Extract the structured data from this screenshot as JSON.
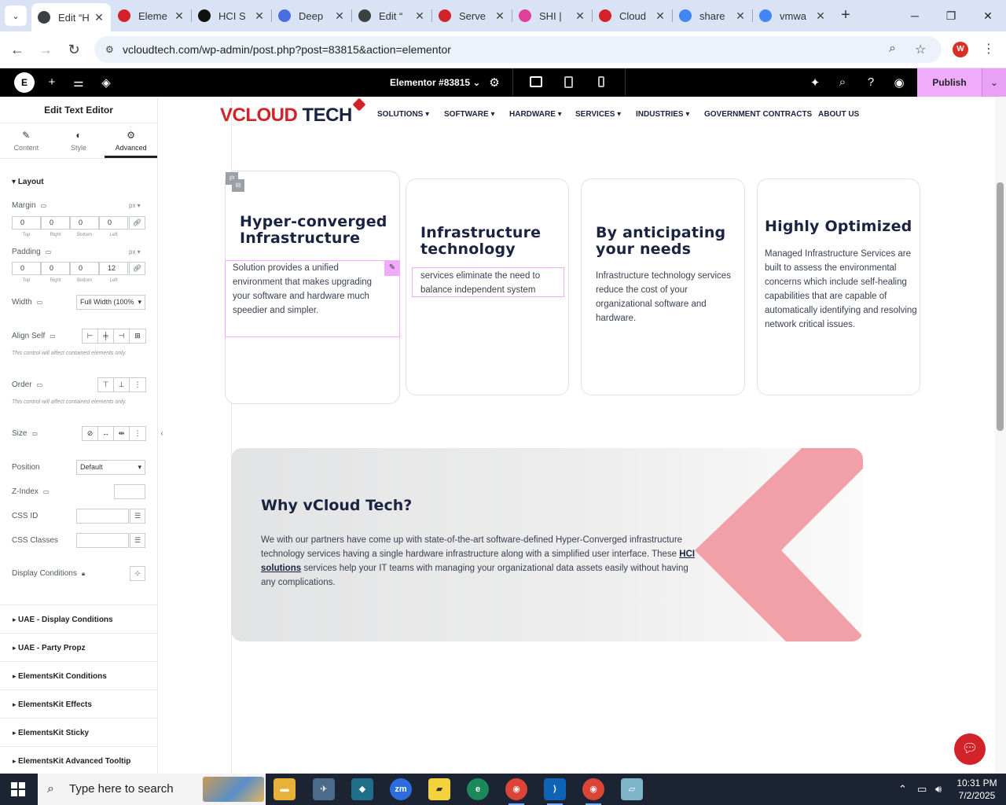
{
  "browser": {
    "tabs": [
      {
        "label": "Edit “H",
        "icon": "wordpress-icon",
        "color": "#3c4043",
        "active": true
      },
      {
        "label": "Eleme",
        "icon": "elementor-diamond-icon",
        "color": "#d2232a"
      },
      {
        "label": "HCI S",
        "icon": "openai-icon",
        "color": "#111111"
      },
      {
        "label": "Deep",
        "icon": "deepl-icon",
        "color": "#4a6ee0"
      },
      {
        "label": "Edit “",
        "icon": "wordpress-icon",
        "color": "#3c4043"
      },
      {
        "label": "Serve",
        "icon": "elementor-diamond-icon",
        "color": "#d2232a"
      },
      {
        "label": "SHI | ",
        "icon": "shi-ring-icon",
        "color": "#e0419a"
      },
      {
        "label": "Cloud",
        "icon": "cloud-logo-icon",
        "color": "#d2232a"
      },
      {
        "label": "share",
        "icon": "google-icon",
        "color": "#4285f4"
      },
      {
        "label": "vmwa",
        "icon": "google-icon",
        "color": "#4285f4"
      }
    ],
    "url": "vcloudtech.com/wp-admin/post.php?post=83815&action=elementor"
  },
  "editor": {
    "document_label": "Elementor #83815",
    "publish_label": "Publish"
  },
  "panel": {
    "title": "Edit Text Editor",
    "tabs": [
      {
        "label": "Content",
        "icon": "pencil-icon"
      },
      {
        "label": "Style",
        "icon": "half-circle-icon"
      },
      {
        "label": "Advanced",
        "icon": "gear-icon",
        "active": true
      }
    ],
    "section_layout": "Layout",
    "margin": {
      "label": "Margin",
      "unit": "px",
      "top": "0",
      "right": "0",
      "bottom": "0",
      "left": "0"
    },
    "padding": {
      "label": "Padding",
      "unit": "px",
      "top": "0",
      "right": "0",
      "bottom": "0",
      "left": "12"
    },
    "dim_captions": {
      "top": "Top",
      "right": "Right",
      "bottom": "Bottom",
      "left": "Left"
    },
    "width": {
      "label": "Width",
      "value": "Full Width (100%"
    },
    "align_self": {
      "label": "Align Self",
      "hint": "This control will affect contained elements only."
    },
    "order": {
      "label": "Order",
      "hint": "This control will affect contained elements only."
    },
    "size": {
      "label": "Size"
    },
    "position": {
      "label": "Position",
      "value": "Default"
    },
    "zindex": {
      "label": "Z-Index"
    },
    "css_id": {
      "label": "CSS ID"
    },
    "css_classes": {
      "label": "CSS Classes"
    },
    "display_conditions": {
      "label": "Display Conditions"
    },
    "accordions": [
      "UAE - Display Conditions",
      "UAE - Party Propz",
      "ElementsKit Conditions",
      "ElementsKit Effects",
      "ElementsKit Sticky",
      "ElementsKit Advanced Tooltip"
    ]
  },
  "site": {
    "logo_v": "V",
    "logo_cloud": "CLOUD",
    "logo_tech": "TECH",
    "menu": [
      "SOLUTIONS",
      "SOFTWARE",
      "HARDWARE",
      "SERVICES",
      "INDUSTRIES",
      "GOVERNMENT CONTRACTS",
      "ABOUT US"
    ],
    "cards": [
      {
        "title": "Hyper-converged Infrastructure",
        "text": "Solution provides a unified environment that makes upgrading your software and hardware much speedier and simpler."
      },
      {
        "title": "Infrastructure technology",
        "text": "services eliminate the need to balance independent system"
      },
      {
        "title": "By anticipating your needs",
        "text": "Infrastructure technology services reduce the cost of your organizational software and hardware."
      },
      {
        "title": "Highly Optimized",
        "text": "Managed Infrastructure Services are built to assess the environmental concerns which include self-healing capabilities that are capable of automatically identifying and resolving network critical issues."
      }
    ],
    "why": {
      "title": "Why vCloud Tech?",
      "text_before": "We with our partners have come up with state-of-the-art software-defined Hyper-Converged infrastructure technology services having a single hardware infrastructure along with a simplified user interface. These ",
      "link": "HCI solutions",
      "text_after": " services help your IT teams with managing your organizational data assets easily without having any complications."
    }
  },
  "taskbar": {
    "search_placeholder": "Type here to search",
    "time": "10:31 PM",
    "date": "7/2/2025"
  },
  "colors": {
    "accent_pink": "#f0abfc",
    "brand_red": "#d2232a",
    "navy": "#1a2440",
    "chevron_pink": "#f2a0a8"
  }
}
